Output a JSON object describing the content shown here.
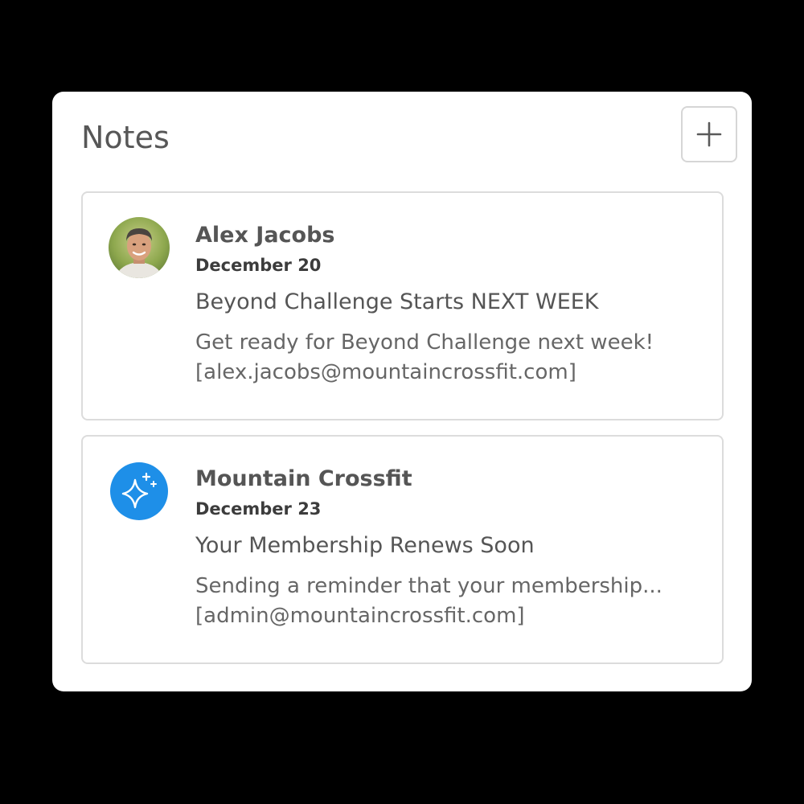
{
  "panel": {
    "title": "Notes",
    "add_button_icon": "plus-icon"
  },
  "notes": [
    {
      "author": "Alex Jacobs",
      "date": "December 20",
      "subject": "Beyond Challenge Starts NEXT WEEK",
      "preview": "Get ready for Beyond Challenge next week!",
      "email": "[alex.jacobs@mountaincrossfit.com]",
      "avatar_icon": "person-photo-avatar"
    },
    {
      "author": "Mountain Crossfit",
      "date": "December 23",
      "subject": "Your Membership Renews Soon",
      "preview": "Sending a reminder that your membership...",
      "email": "[admin@mountaincrossfit.com]",
      "avatar_icon": "sparkle-icon",
      "avatar_color": "#1e8fe8"
    }
  ]
}
